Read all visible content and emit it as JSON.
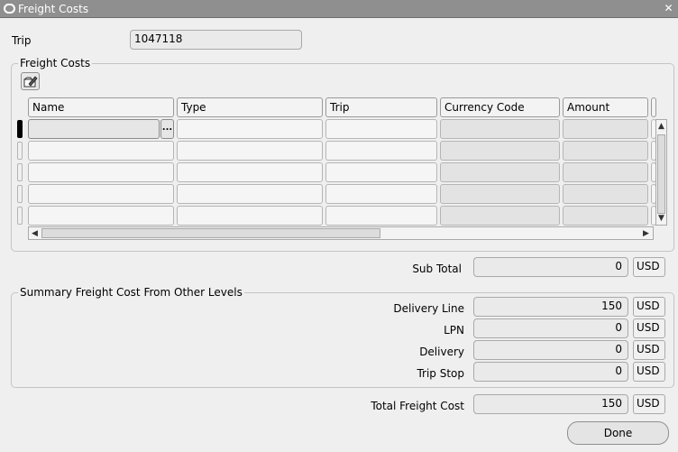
{
  "window": {
    "title": "Freight Costs",
    "close_glyph": "✕"
  },
  "trip": {
    "label": "Trip",
    "value": "1047118"
  },
  "freight_costs": {
    "group_label": "Freight Costs",
    "toolbar_icon": "folder-edit-icon",
    "columns": [
      "Name",
      "Type",
      "Trip",
      "Currency Code",
      "Amount"
    ],
    "lov_glyph": "...",
    "row_count": 5
  },
  "sub_total": {
    "label": "Sub Total",
    "value": "0",
    "currency": "USD"
  },
  "summary": {
    "group_label": "Summary Freight Cost From Other Levels",
    "items": [
      {
        "label": "Delivery Line",
        "value": "150",
        "currency": "USD"
      },
      {
        "label": "LPN",
        "value": "0",
        "currency": "USD"
      },
      {
        "label": "Delivery",
        "value": "0",
        "currency": "USD"
      },
      {
        "label": "Trip Stop",
        "value": "0",
        "currency": "USD"
      }
    ]
  },
  "total": {
    "label": "Total Freight Cost",
    "value": "150",
    "currency": "USD"
  },
  "buttons": {
    "done": "Done"
  },
  "colors": {
    "titlebar": "#8f8f8f",
    "background": "#efefef"
  }
}
